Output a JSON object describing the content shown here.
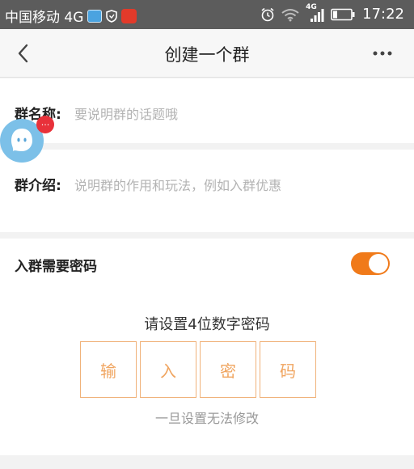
{
  "status_bar": {
    "carrier": "中国移动 4G",
    "network": "4G",
    "time": "17:22"
  },
  "nav": {
    "title": "创建一个群"
  },
  "group_name": {
    "label": "群名称:",
    "placeholder": "要说明群的话题哦"
  },
  "group_intro": {
    "label": "群介绍:",
    "placeholder": "说明群的作用和玩法，例如入群优惠"
  },
  "password": {
    "toggle_label": "入群需要密码",
    "toggle_on": true,
    "title": "请设置4位数字密码",
    "boxes": [
      "输",
      "入",
      "密",
      "码"
    ],
    "note": "一旦设置无法修改"
  },
  "assistant": {
    "badge": "..."
  },
  "colors": {
    "accent": "#f07a1a",
    "box_border": "#f0b27a",
    "badge": "#e8313a"
  }
}
